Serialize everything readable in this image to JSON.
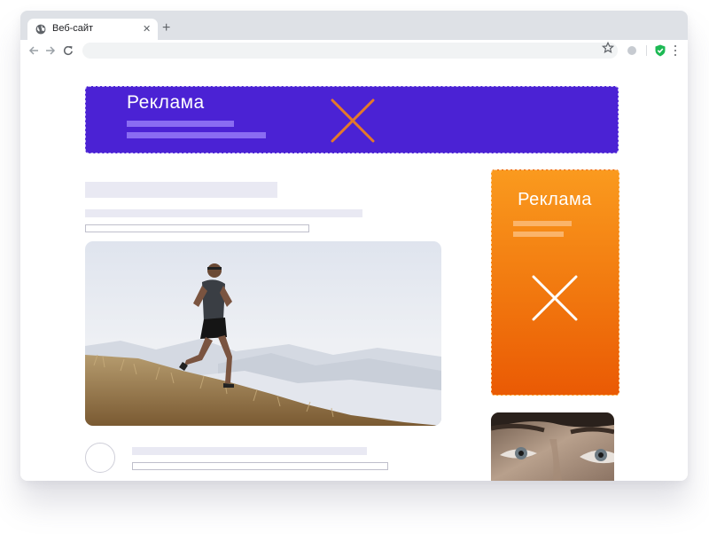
{
  "browser": {
    "tab": {
      "title": "Веб-сайт",
      "icon": "globe-icon",
      "close_glyph": "✕"
    },
    "new_tab_glyph": "+",
    "toolbar_icons": [
      "back-arrow-icon",
      "forward-arrow-icon",
      "reload-icon",
      "star-icon",
      "profile-avatar-icon",
      "adblock-shield-icon",
      "menu-dots-icon"
    ]
  },
  "page": {
    "top_ad": {
      "title": "Реклама",
      "close_icon": "close-x-icon"
    },
    "side_ad": {
      "title": "Реклама",
      "close_icon": "close-x-icon"
    },
    "hero_image": "runner-on-mountain-photo",
    "thumbnail_image": "man-eyes-closeup-photo"
  },
  "colors": {
    "top_ad_bg": "#4b22d4",
    "top_ad_close": "#e4792a",
    "side_ad_bg_top": "#fa9a1e",
    "side_ad_bg_bottom": "#ea5a04",
    "adblock_shield": "#1db954",
    "placeholder": "#e9e9f3"
  }
}
